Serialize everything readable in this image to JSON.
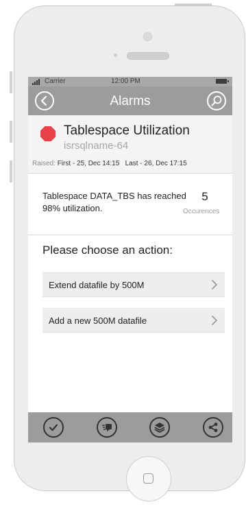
{
  "status_bar": {
    "carrier": "Carrier",
    "time": "12:00 PM"
  },
  "nav": {
    "title": "Alarms",
    "back_icon": "chevron-left-icon",
    "search_icon": "search-icon"
  },
  "alarm": {
    "title": "Tablespace Utilization",
    "host": "isrsqlname-64",
    "severity_color": "#e8414a",
    "raised_label": "Raised:",
    "first": "First - 25, Dec 14:15",
    "last": "Last - 26, Dec 17:15"
  },
  "message": {
    "text": "Tablespace DATA_TBS has reached 98% utilization.",
    "occurrences": "5",
    "occurrences_label": "Occurences"
  },
  "actions": {
    "heading": "Please choose an action:",
    "items": [
      {
        "label": "Extend datafile by 500M"
      },
      {
        "label": "Add a new 500M datafile"
      }
    ]
  },
  "tabbar": {
    "icons": [
      "check-icon",
      "comment-icon",
      "layers-icon",
      "share-icon"
    ]
  },
  "colors": {
    "bar_gray": "#9c9c9c",
    "status_gray": "#a8a8a8",
    "action_bg": "#eeeeee"
  }
}
